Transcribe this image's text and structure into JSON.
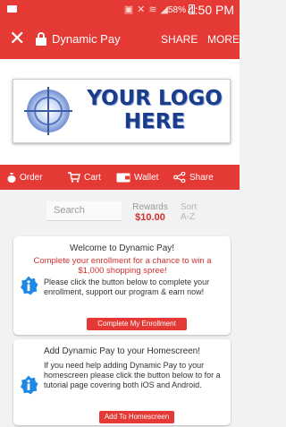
{
  "status_bar": {
    "battery": "58%",
    "time": "4:50 PM"
  },
  "app_bar": {
    "title": "Dynamic Pay",
    "share_label": "SHARE",
    "more_label": "MORE"
  },
  "logo": {
    "line1": "YOUR LOGO",
    "line2": "HERE"
  },
  "nav": {
    "items": [
      {
        "label": "Order",
        "icon": "moneybag-icon"
      },
      {
        "label": "Cart",
        "icon": "cart-icon"
      },
      {
        "label": "Wallet",
        "icon": "wallet-icon"
      },
      {
        "label": "Share",
        "icon": "share-icon"
      }
    ]
  },
  "search": {
    "placeholder": "Search"
  },
  "rewards": {
    "label": "Rewards",
    "value": "$10.00"
  },
  "sort": {
    "label": "Sort",
    "value": "A-Z"
  },
  "cards": [
    {
      "title": "Welcome to Dynamic Pay!",
      "highlight": "Complete your enrollment for a chance to win a $1,000 shopping spree!",
      "body": "Please click the button below to complete your enrollment, support our program & earn now!",
      "button": "Complete My Enrollment"
    },
    {
      "title": "Add Dynamic Pay to your Homescreen!",
      "body": "If you need help adding Dynamic Pay to your homescreen please click the button below to for a tutorial page covering both iOS and Android.",
      "button": "Add To Homescreen"
    }
  ],
  "colors": {
    "brand_red": "#e53935",
    "logo_blue": "#1a3c8a",
    "info_icon_blue": "#1e88e5"
  }
}
